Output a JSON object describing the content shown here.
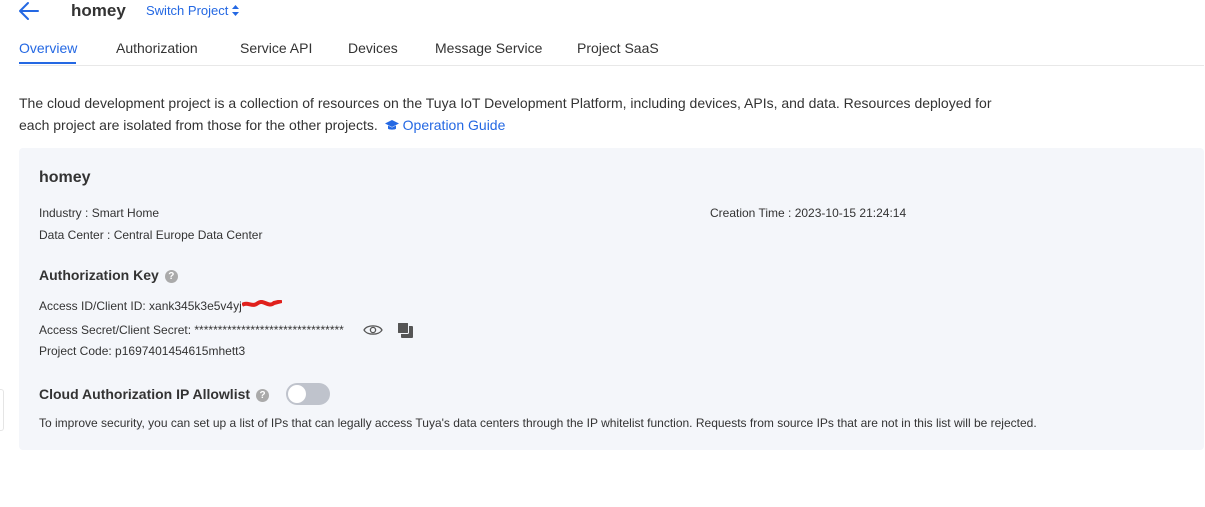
{
  "header": {
    "project_name": "homey",
    "switch_label": "Switch Project"
  },
  "tabs": [
    {
      "label": "Overview",
      "active": true
    },
    {
      "label": "Authorization",
      "active": false
    },
    {
      "label": "Service API",
      "active": false
    },
    {
      "label": "Devices",
      "active": false
    },
    {
      "label": "Message Service",
      "active": false
    },
    {
      "label": "Project SaaS",
      "active": false
    }
  ],
  "description": {
    "text": "The cloud development project is a collection of resources on the Tuya IoT Development Platform, including devices, APIs, and data. Resources deployed for each project are isolated from those for the other projects.",
    "guide_label": "Operation Guide"
  },
  "project": {
    "title": "homey",
    "industry_label": "Industry : ",
    "industry_value": "Smart Home",
    "data_center_label": "Data Center : ",
    "data_center_value": "Central Europe Data Center",
    "creation_label": "Creation Time : ",
    "creation_value": "2023-10-15 21:24:14"
  },
  "auth_key": {
    "title": "Authorization Key",
    "access_id_label": "Access ID/Client ID: ",
    "access_id_value": "xank345k3e5v4yj",
    "secret_label": "Access Secret/Client Secret: ",
    "secret_value": "********************************",
    "project_code_label": "Project Code: ",
    "project_code_value": "p1697401454615mhett3"
  },
  "allowlist": {
    "title": "Cloud Authorization IP Allowlist",
    "enabled": false,
    "note": "To improve security, you can set up a list of IPs that can legally access Tuya's data centers through the IP whitelist function. Requests from source IPs that are not in this list will be rejected."
  },
  "colors": {
    "accent": "#2468e3",
    "card_bg": "#f4f6fa",
    "toggle_off": "#bfc3cc"
  },
  "icons": [
    "arrow-left-icon",
    "sort-icon",
    "graduation-cap-icon",
    "help-icon",
    "eye-icon",
    "copy-icon"
  ]
}
